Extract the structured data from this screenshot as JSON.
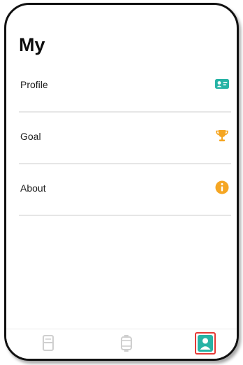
{
  "header": {
    "title": "My"
  },
  "menu": {
    "items": [
      {
        "label": "Profile",
        "icon": "profile-card-icon",
        "icon_color": "#26b3a5"
      },
      {
        "label": "Goal",
        "icon": "trophy-icon",
        "icon_color": "#f5a623"
      },
      {
        "label": "About",
        "icon": "info-icon",
        "icon_color": "#f5a623"
      }
    ]
  },
  "bottom_nav": {
    "tabs": [
      {
        "icon": "calendar-icon",
        "active": false
      },
      {
        "icon": "device-icon",
        "active": false
      },
      {
        "icon": "person-icon",
        "active": true
      }
    ],
    "accent_color": "#26b3a5",
    "highlight_color": "#e53935"
  }
}
